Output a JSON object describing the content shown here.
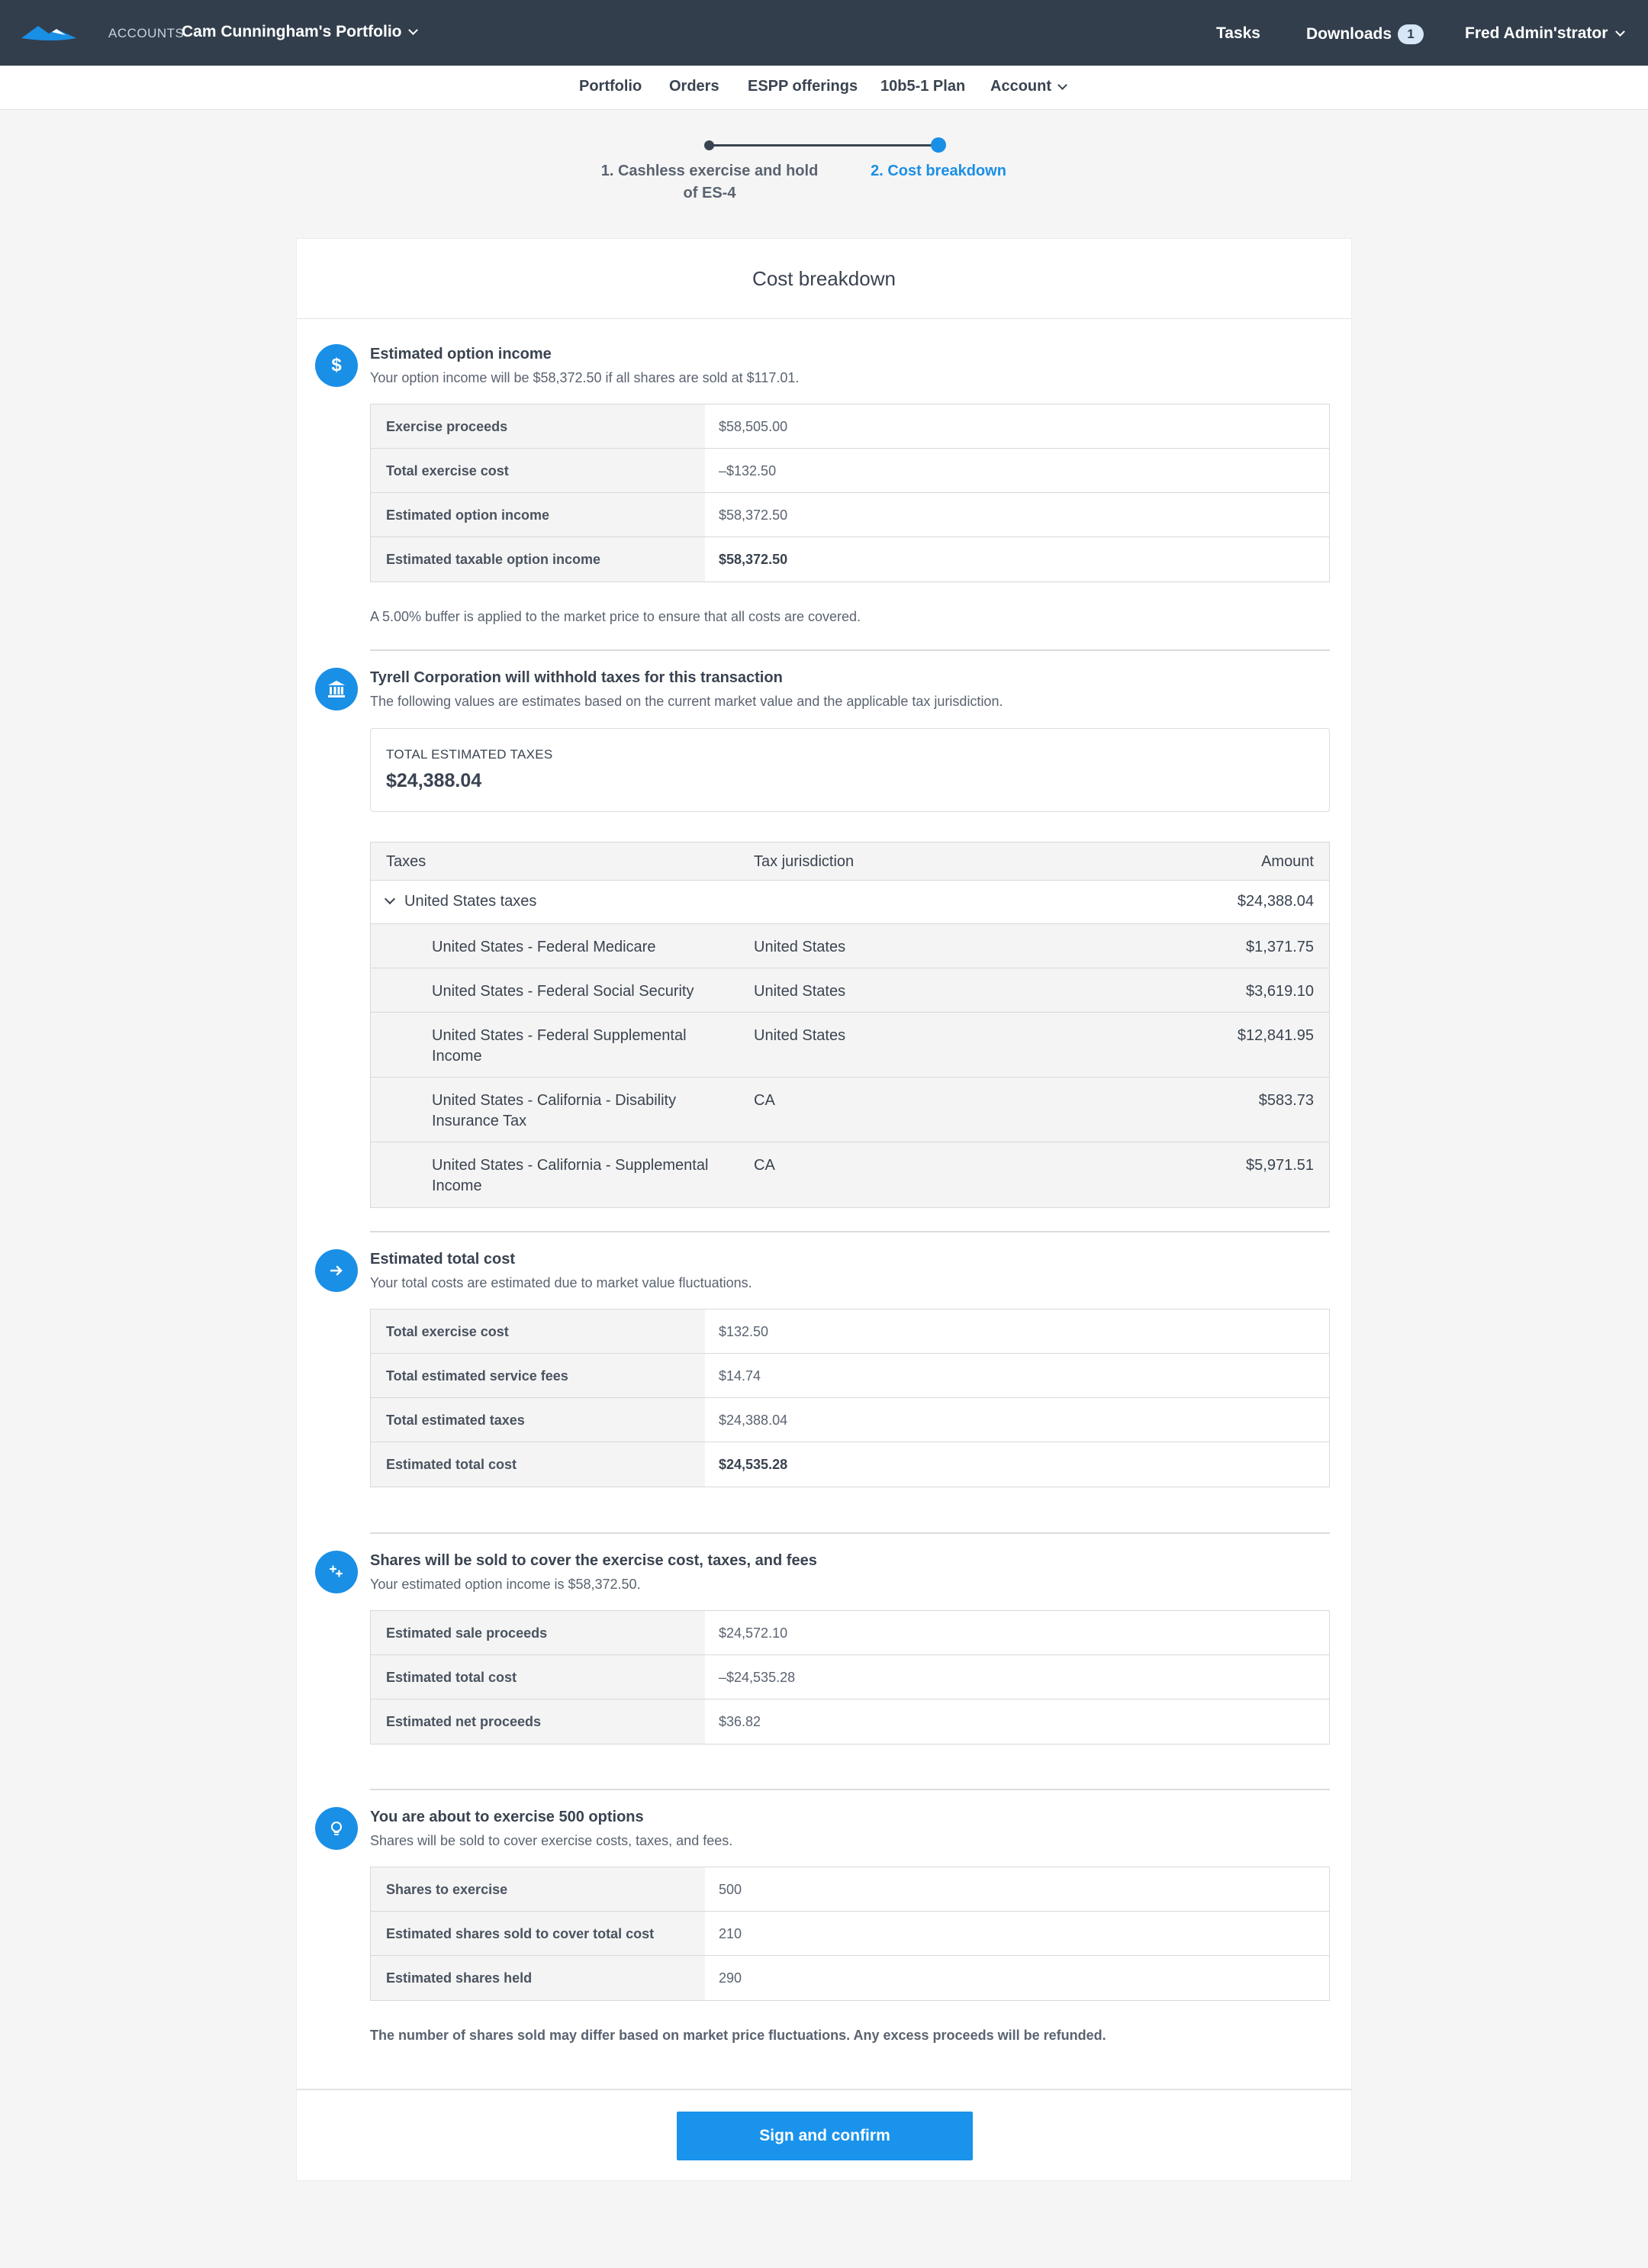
{
  "header": {
    "accounts_label": "ACCOUNTS",
    "portfolio_name": "Cam Cunningham's Portfolio",
    "tasks": "Tasks",
    "downloads": "Downloads",
    "downloads_count": "1",
    "user": "Fred Admin'strator",
    "bg_color": "#323e4c"
  },
  "subnav": {
    "items": [
      "Portfolio",
      "Orders",
      "ESPP offerings",
      "10b5-1 Plan",
      "Account"
    ]
  },
  "stepper": {
    "step1": "1. Cashless exercise and hold of ES-4",
    "step2": "2. Cost breakdown",
    "accent": "#1a8fe6"
  },
  "card": {
    "title": "Cost breakdown"
  },
  "option_income": {
    "icon": "dollar-icon",
    "title": "Estimated option income",
    "subtitle": "Your option income will be $58,372.50 if all shares are sold at $117.01.",
    "rows": [
      {
        "label": "Exercise proceeds",
        "value": "$58,505.00"
      },
      {
        "label": "Total exercise cost",
        "value": "–$132.50"
      },
      {
        "label": "Estimated option income",
        "value": "$58,372.50"
      },
      {
        "label": "Estimated taxable option income",
        "value": "$58,372.50"
      }
    ],
    "note": "A 5.00% buffer is applied to the market price to ensure that all costs are covered."
  },
  "taxes": {
    "icon": "bank-icon",
    "title": "Tyrell Corporation will withhold taxes for this transaction",
    "subtitle": "The following values are estimates based on the current market value and the applicable tax jurisdiction.",
    "total_label": "TOTAL ESTIMATED TAXES",
    "total_value": "$24,388.04",
    "columns": [
      "Taxes",
      "Tax jurisdiction",
      "Amount"
    ],
    "group": {
      "name": "United States taxes",
      "amount": "$24,388.04"
    },
    "rows": [
      {
        "name": "United States - Federal Medicare",
        "jurisdiction": "United States",
        "amount": "$1,371.75"
      },
      {
        "name": "United States - Federal Social Security",
        "jurisdiction": "United States",
        "amount": "$3,619.10"
      },
      {
        "name": "United States - Federal Supplemental Income",
        "jurisdiction": "United States",
        "amount": "$12,841.95"
      },
      {
        "name": "United States - California - Disability Insurance Tax",
        "jurisdiction": "CA",
        "amount": "$583.73"
      },
      {
        "name": "United States - California - Supplemental Income",
        "jurisdiction": "CA",
        "amount": "$5,971.51"
      }
    ]
  },
  "total_cost": {
    "icon": "arrow-right-icon",
    "title": "Estimated total cost",
    "subtitle": "Your total costs are estimated due to market value fluctuations.",
    "rows": [
      {
        "label": "Total exercise cost",
        "value": "$132.50"
      },
      {
        "label": "Total estimated service fees",
        "value": "$14.74"
      },
      {
        "label": "Total estimated taxes",
        "value": "$24,388.04"
      },
      {
        "label": "Estimated total cost",
        "value": "$24,535.28"
      }
    ]
  },
  "shares_sold": {
    "icon": "split-icon",
    "title": "Shares will be sold to cover the exercise cost, taxes, and fees",
    "subtitle": "Your estimated option income is $58,372.50.",
    "rows": [
      {
        "label": "Estimated sale proceeds",
        "value": "$24,572.10"
      },
      {
        "label": "Estimated total cost",
        "value": "–$24,535.28"
      },
      {
        "label": "Estimated net proceeds",
        "value": "$36.82"
      }
    ]
  },
  "exercise": {
    "icon": "lightbulb-icon",
    "title": "You are about to exercise 500 options",
    "subtitle": "Shares will be sold to cover exercise costs, taxes, and fees.",
    "rows": [
      {
        "label": "Shares to exercise",
        "value": "500"
      },
      {
        "label": "Estimated shares sold to cover total cost",
        "value": "210"
      },
      {
        "label": "Estimated shares held",
        "value": "290"
      }
    ],
    "note": "The number of shares sold may differ based on market price fluctuations. Any excess proceeds will be refunded."
  },
  "footer": {
    "confirm_label": "Sign and confirm"
  }
}
